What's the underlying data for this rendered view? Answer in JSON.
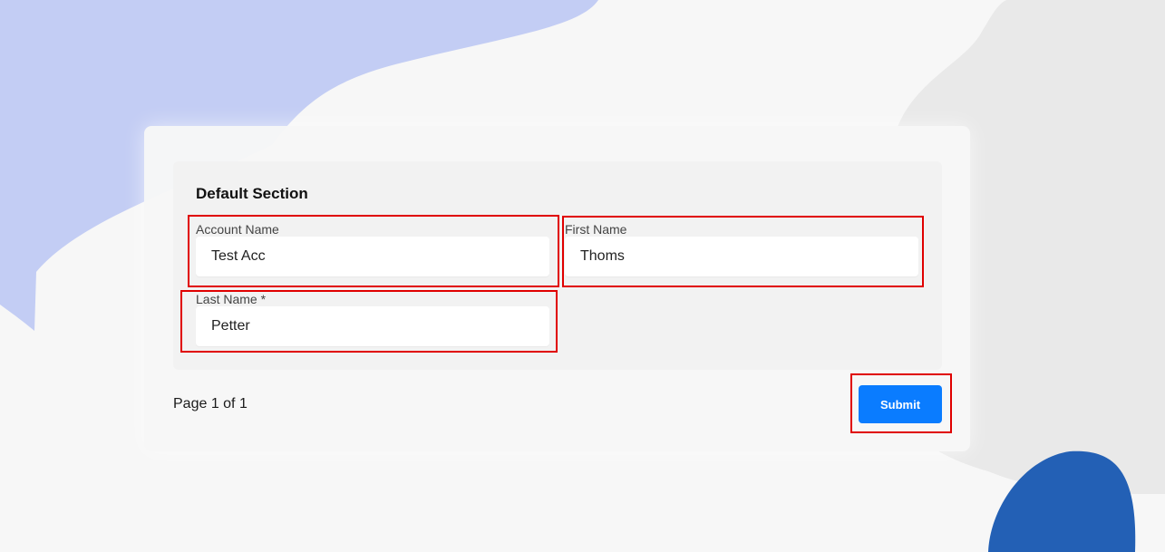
{
  "form": {
    "section_title": "Default Section",
    "fields": {
      "account_name": {
        "label": "Account Name",
        "value": "Test Acc"
      },
      "first_name": {
        "label": "First Name",
        "value": "Thoms"
      },
      "last_name": {
        "label": "Last Name *",
        "value": "Petter"
      }
    },
    "pagination": "Page 1 of 1",
    "submit_label": "Submit"
  },
  "colors": {
    "accent": "#0a7cff",
    "highlight": "#e00000",
    "blob_light_blue": "#c3cdf4",
    "blob_dark_blue": "#2360b5",
    "blob_gray": "#e9e9e9"
  }
}
